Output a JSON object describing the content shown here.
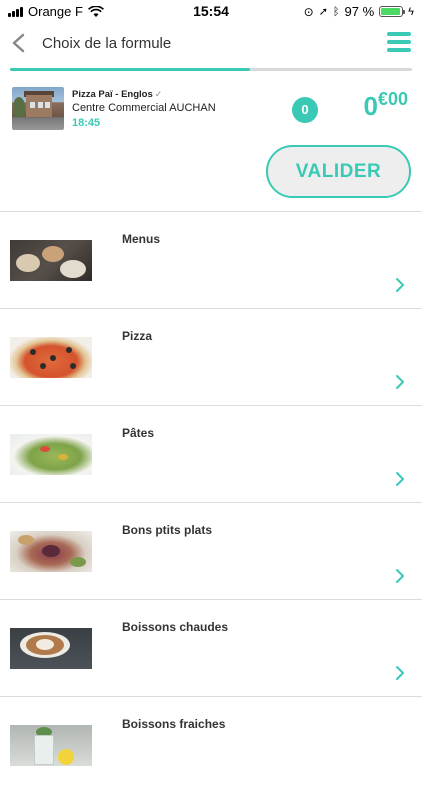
{
  "status_bar": {
    "carrier": "Orange F",
    "time": "15:54",
    "battery": "97 %"
  },
  "nav": {
    "title": "Choix de la formule"
  },
  "progress": 0.597,
  "shop": {
    "name": "Pizza Paï - Englos",
    "location": "Centre Commercial AUCHAN",
    "time": "18:45"
  },
  "cart": {
    "count": "0",
    "price_int": "0",
    "price_cur": "€00"
  },
  "validate_label": "VALIDER",
  "categories": [
    {
      "label": "Menus"
    },
    {
      "label": "Pizza"
    },
    {
      "label": "Pâtes"
    },
    {
      "label": "Bons ptits plats"
    },
    {
      "label": "Boissons chaudes"
    },
    {
      "label": "Boissons fraiches"
    }
  ],
  "colors": {
    "accent": "#39c9b4",
    "divider": "#dcdcdc"
  }
}
